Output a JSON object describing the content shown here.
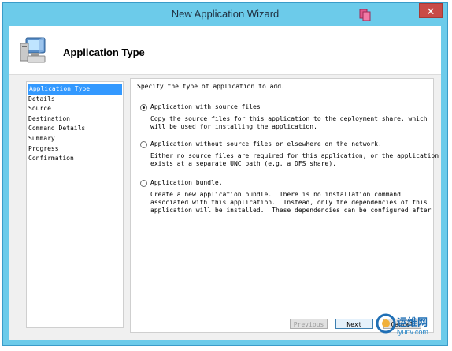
{
  "window": {
    "title": "New Application Wizard",
    "close_glyph": "✕",
    "title_icon": "wizard-app-icon",
    "accent": "#6ccbea"
  },
  "header": {
    "title": "Application Type",
    "icon": "computer-icon"
  },
  "nav": {
    "items": [
      {
        "label": "Application Type",
        "active": true
      },
      {
        "label": "Details",
        "active": false
      },
      {
        "label": "Source",
        "active": false
      },
      {
        "label": "Destination",
        "active": false
      },
      {
        "label": "Command Details",
        "active": false
      },
      {
        "label": "Summary",
        "active": false
      },
      {
        "label": "Progress",
        "active": false
      },
      {
        "label": "Confirmation",
        "active": false
      }
    ],
    "active_color": "#3399ff"
  },
  "content": {
    "prompt": "Specify the type of application to add.",
    "options": [
      {
        "label": "Application with source files",
        "checked": true,
        "description": "Copy the source files for this application to the deployment share, which\nwill be used for installing the application."
      },
      {
        "label": "Application without source files or elsewhere on the network.",
        "checked": false,
        "description": "Either no source files are required for this application, or the application\nexists at a separate UNC path (e.g. a DFS share)."
      },
      {
        "label": "Application bundle.",
        "checked": false,
        "description": "Create a new application bundle.  There is no installation command\nassociated with this application.  Instead, only the dependencies of this\napplication will be installed.  These dependencies can be configured after"
      }
    ]
  },
  "buttons": {
    "previous": "Previous",
    "next": "Next",
    "cancel": "Cancel"
  },
  "watermark": {
    "line1": "运维网",
    "line2": "iyunv.com"
  }
}
